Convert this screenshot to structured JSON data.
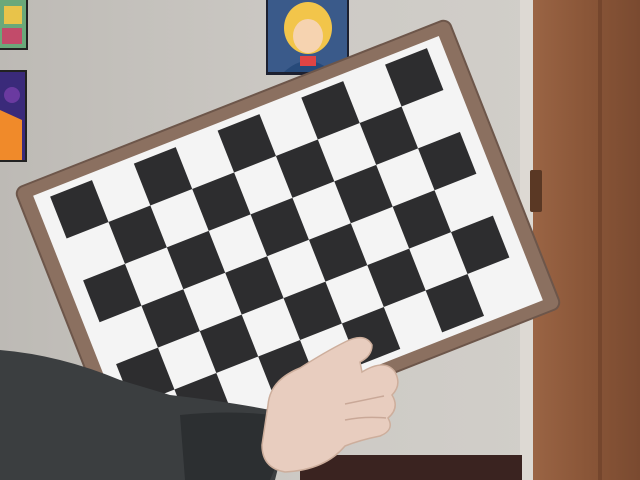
{
  "scene": {
    "description_kind": "photo",
    "subject": "calibration-checkerboard",
    "board": {
      "inner_corners_cols": 8,
      "inner_corners_rows": 5,
      "squares_cols": 9,
      "squares_rows": 6
    }
  },
  "colors": {
    "wall": "#cac7c2",
    "door": "#8f5a3c",
    "door_dark": "#6e4229",
    "baseboard": "#3a2320",
    "clipboard": "#8b7060",
    "paper": "#f4f4f4",
    "square_dark": "#2d2d2f",
    "sleeve": "#3b3e40",
    "skin": "#e8cdbf"
  }
}
